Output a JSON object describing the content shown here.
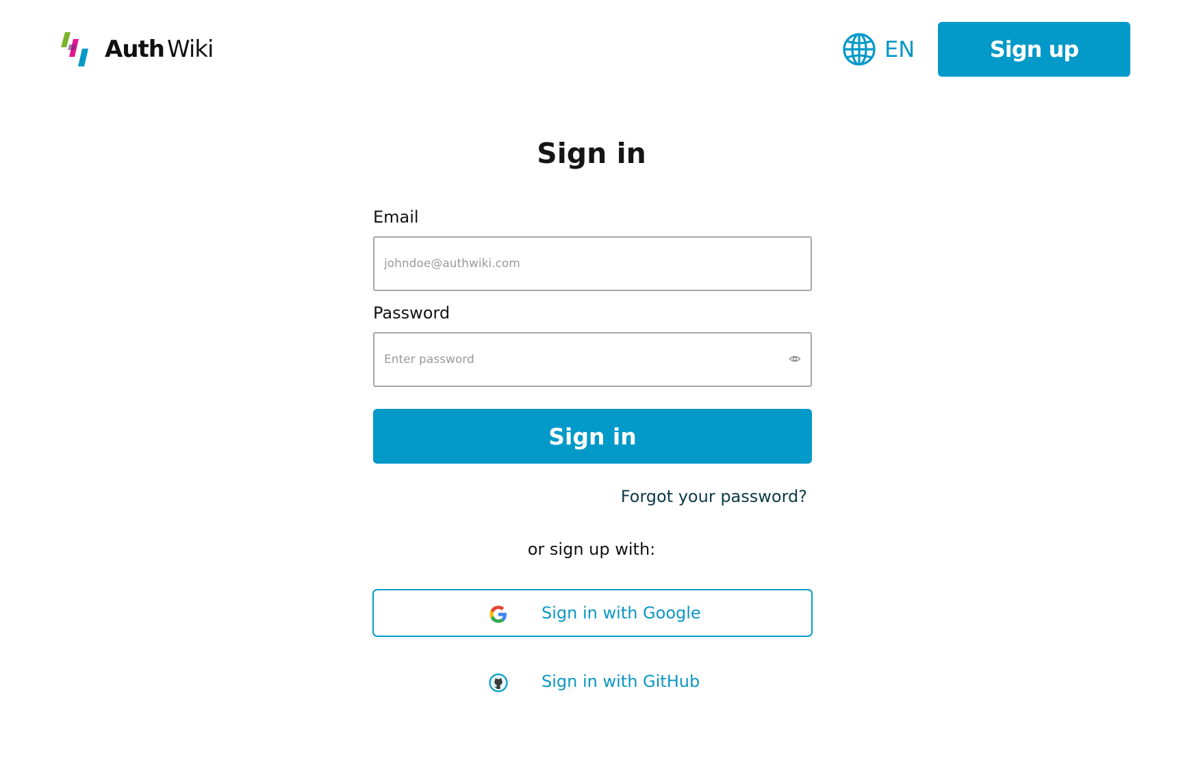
{
  "brand": {
    "name_bold": "Auth",
    "name_light": "Wiki",
    "colors": {
      "green": "#7bb42a",
      "magenta": "#e2168f",
      "blue": "#0399c8"
    }
  },
  "header": {
    "language": {
      "icon": "globe-icon",
      "label": "EN"
    },
    "signup_button": "Sign up"
  },
  "form": {
    "title": "Sign in",
    "email": {
      "label": "Email",
      "placeholder": "johndoe@authwiki.com",
      "value": ""
    },
    "password": {
      "label": "Password",
      "placeholder": "Enter password",
      "value": "",
      "toggle_icon": "eye-icon"
    },
    "submit_label": "Sign in",
    "forgot_link": "Forgot your password?",
    "divider_text": "or sign up with:"
  },
  "social": {
    "google": {
      "icon": "google-icon",
      "label": "Sign in with Google"
    },
    "github": {
      "icon": "github-icon",
      "label": "Sign in with GitHub"
    }
  },
  "theme": {
    "accent": "#0399c8",
    "link_dark": "#0b3948",
    "border": "#a6a6a6"
  }
}
